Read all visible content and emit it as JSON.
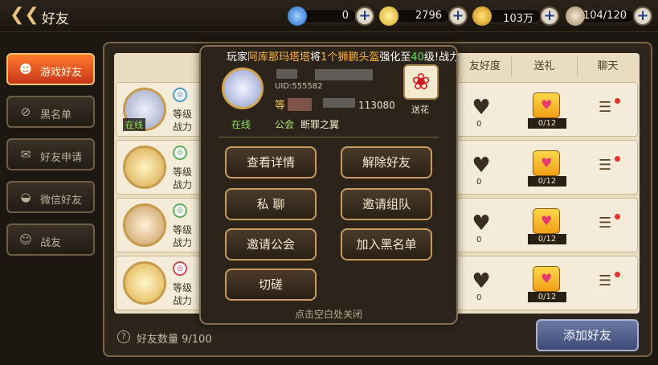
{
  "header": {
    "title": "好友",
    "back_icon": "back-arrow-icon",
    "resources": [
      {
        "name": "gem",
        "icon": "blue-crystal-icon",
        "value": "0"
      },
      {
        "name": "energy",
        "icon": "yellow-swirl-icon",
        "value": "2796"
      },
      {
        "name": "gold",
        "icon": "gold-coin-icon",
        "value": "103万"
      },
      {
        "name": "stamina",
        "icon": "feather-icon",
        "value": "104/120"
      }
    ]
  },
  "sidebar": {
    "items": [
      {
        "label": "游戏好友",
        "icon": "friends-icon",
        "active": true
      },
      {
        "label": "黑名单",
        "icon": "block-icon",
        "active": false
      },
      {
        "label": "好友申请",
        "icon": "request-icon",
        "active": false
      },
      {
        "label": "微信好友",
        "icon": "wechat-icon",
        "active": false
      },
      {
        "label": "战友",
        "icon": "ally-icon",
        "active": false
      }
    ]
  },
  "table": {
    "columns": [
      "友好度",
      "送礼",
      "聊天"
    ],
    "rows": [
      {
        "status": "在线",
        "level_label": "等级",
        "power_label": "战力",
        "friendship": "0",
        "gift_count": "0/12"
      },
      {
        "status": "",
        "level_label": "等级",
        "power_label": "战力",
        "friendship": "0",
        "gift_count": "0/12"
      },
      {
        "status": "",
        "level_label": "等级",
        "power_label": "战力",
        "friendship": "0",
        "gift_count": "0/12"
      },
      {
        "status": "",
        "level_label": "等级",
        "power_label": "战力",
        "friendship": "0",
        "gift_count": "0/12"
      }
    ]
  },
  "footer": {
    "count_label": "好友数量 9/100",
    "add_friend": "添加好友"
  },
  "popup": {
    "marquee_prefix": "玩家",
    "marquee_player": "阿库那玛塔塔",
    "marquee_mid": "将",
    "marquee_item": "1个狮鹏头盔",
    "marquee_mid2": "强化至",
    "marquee_level": "40",
    "marquee_suffix": "级!战力",
    "online": "在线",
    "uid": "UID:555582",
    "level_prefix": "等",
    "power_value": "113080",
    "guild_label": "公会",
    "guild_name": "断罪之翼",
    "flower_label": "送花",
    "buttons": {
      "details": "查看详情",
      "unfriend": "解除好友",
      "private_chat": "私  聊",
      "invite_team": "邀请组队",
      "invite_guild": "邀请公会",
      "blacklist": "加入黑名单",
      "spar": "切磋"
    },
    "close_hint": "点击空白处关闭"
  }
}
